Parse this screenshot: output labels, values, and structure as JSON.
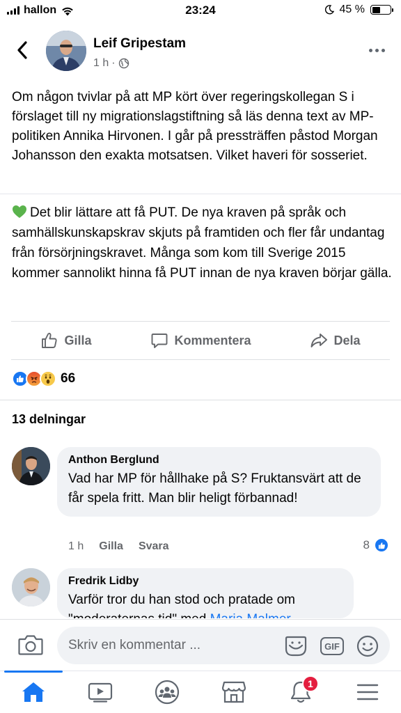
{
  "status_bar": {
    "carrier": "hallon",
    "time": "23:24",
    "battery": "45 %",
    "battery_level": 0.45
  },
  "post": {
    "author": "Leif Gripestam",
    "time": "1 h",
    "privacy_icon": "globe-icon",
    "text": "Om någon tvivlar på att MP kört över regeringskollegan S i förslaget till ny migrationslagstiftning så läs denna text av MP-politiken Annika Hirvonen. I går på pressträffen påstod Morgan Johansson den exakta motsatsen. Vilket haveri för sosseriet.",
    "shared_text": "Det blir lättare att få PUT. De nya kraven på språk och samhällskunskapskrav skjuts på framtiden och fler får undantag från försörjningskravet. Många som kom till Sverige 2015 kommer sannolikt hinna få PUT innan de nya kraven börjar gälla.",
    "shared_emoji": "green-heart-icon"
  },
  "actions": {
    "like": "Gilla",
    "comment": "Kommentera",
    "share": "Dela"
  },
  "reactions": {
    "types": [
      "like-reaction-icon",
      "angry-reaction-icon",
      "wow-reaction-icon"
    ],
    "count": "66"
  },
  "shares": "13 delningar",
  "comments": [
    {
      "name": "Anthon Berglund",
      "text": "Vad har MP för hållhake på S? Fruktansvärt att de får spela fritt. Man blir heligt förbannad!",
      "time": "1 h",
      "like": "Gilla",
      "reply": "Svara",
      "reaction_count": "8"
    },
    {
      "name": "Fredrik Lidby",
      "text_start": "Varför tror du han stod och pratade om \"moderaternas tid\" med ",
      "mention": "Maria Malmer"
    }
  ],
  "composer": {
    "placeholder": "Skriv en kommentar ...",
    "gif": "GIF"
  },
  "tab_bar": {
    "tabs": [
      "home-icon",
      "watch-icon",
      "groups-icon",
      "marketplace-icon",
      "notifications-icon",
      "menu-icon"
    ],
    "notification_badge": "1",
    "colors": {
      "accent": "#1877f2",
      "badge": "#e41e3f"
    }
  }
}
